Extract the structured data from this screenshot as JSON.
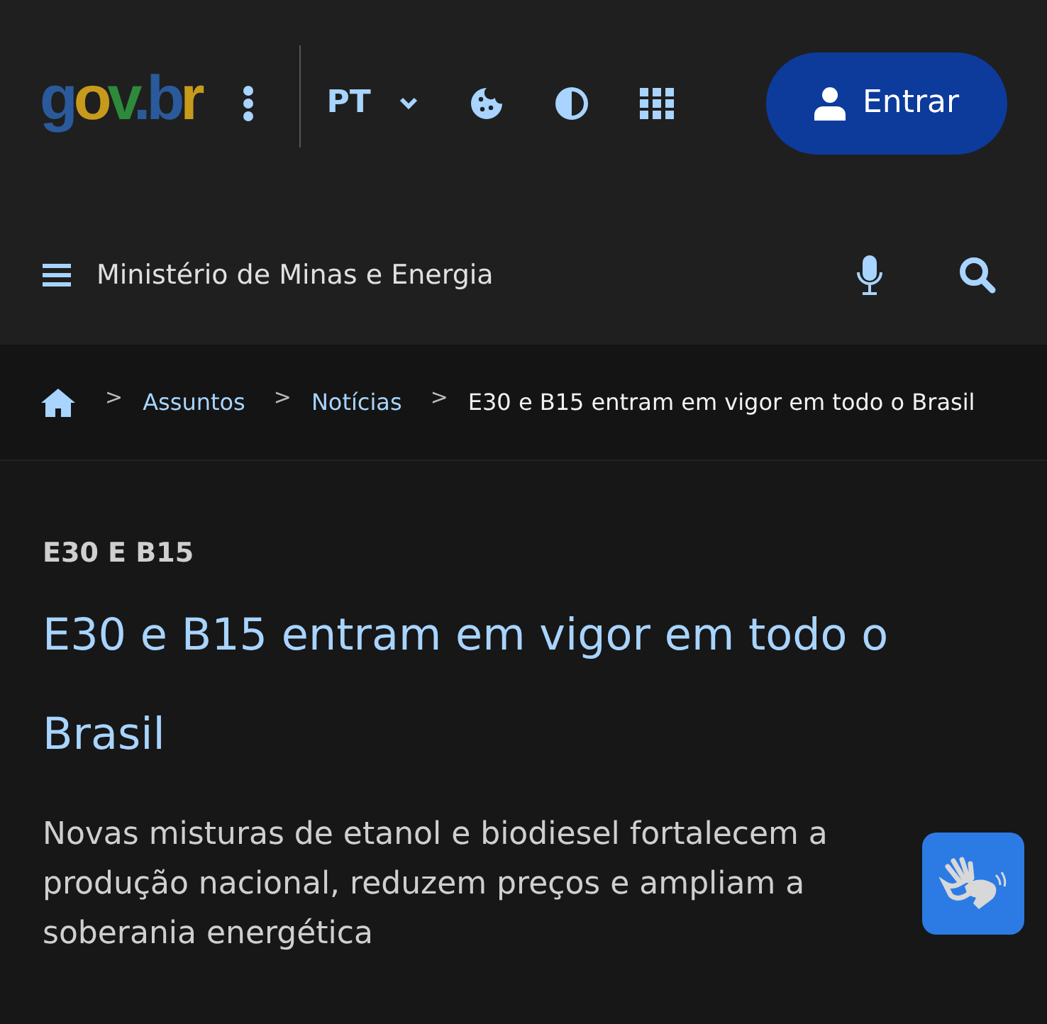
{
  "header": {
    "logo": "gov.br",
    "language": "PT",
    "login_button": "Entrar",
    "site_name": "Ministério de Minas e Energia"
  },
  "breadcrumb": [
    {
      "kind": "home"
    },
    {
      "kind": "link",
      "separator": ">",
      "label": "Assuntos"
    },
    {
      "kind": "link",
      "separator": ">",
      "label": "Notícias"
    },
    {
      "kind": "current",
      "separator": ">",
      "label": "E30 e B15 entram em vigor em todo o Brasil"
    }
  ],
  "article": {
    "tag": "E30 E B15",
    "title": "E30 e B15 entram em vigor em todo o Brasil",
    "subtitle": "Novas misturas de etanol e biodiesel fortalecem a produção nacional, reduzem preços e ampliam a soberania energética"
  }
}
